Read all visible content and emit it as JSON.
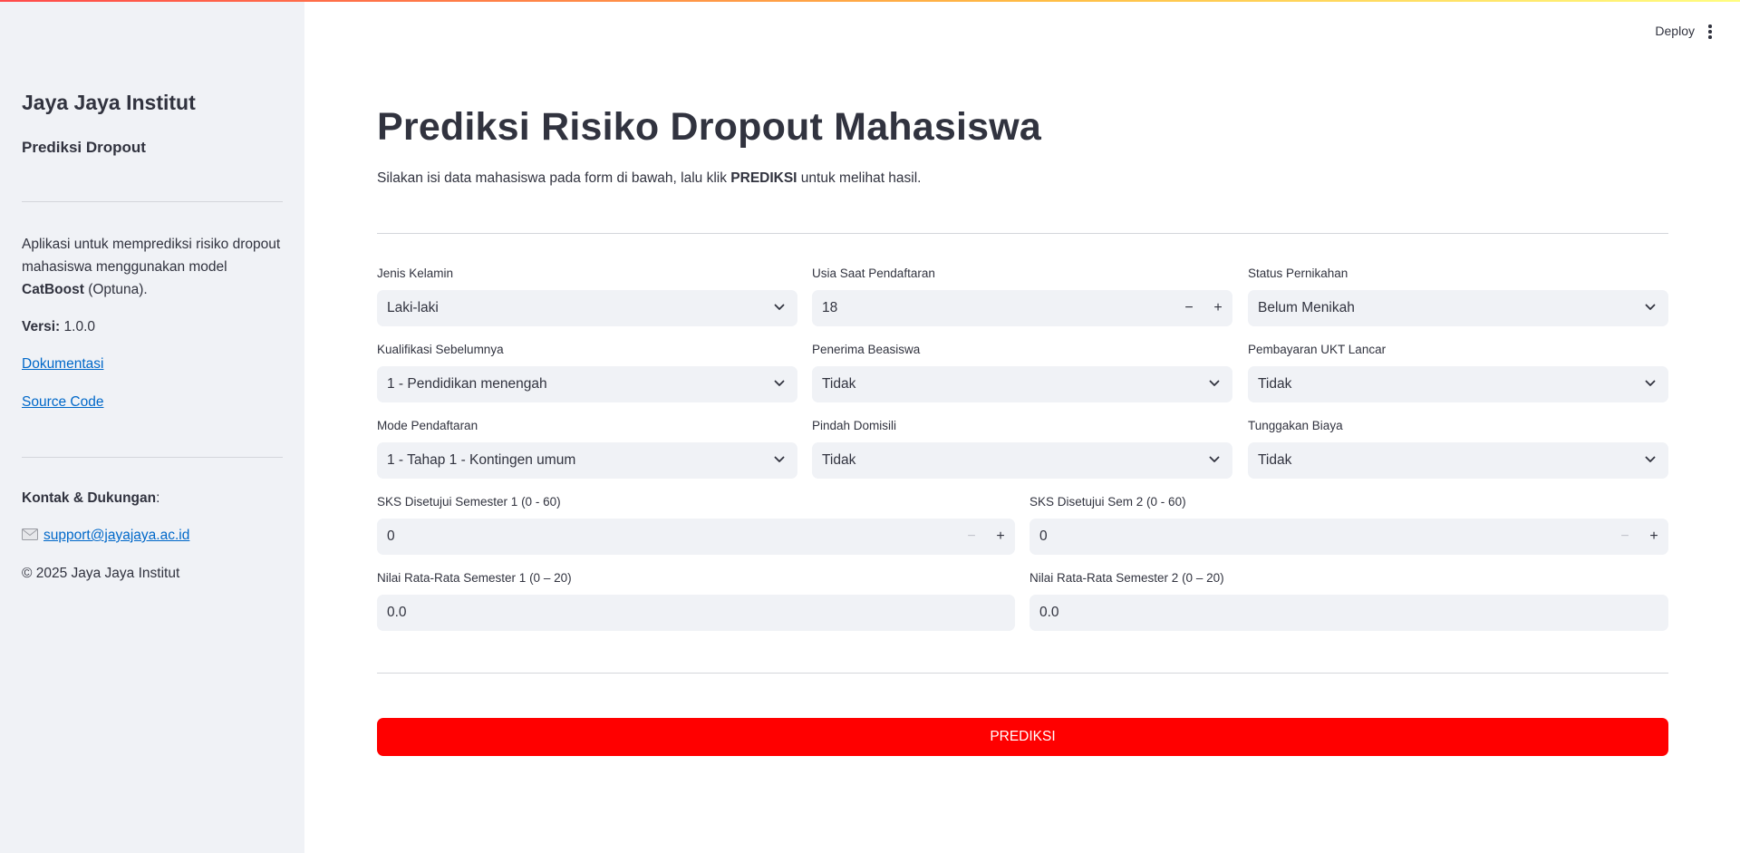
{
  "header": {
    "deploy_label": "Deploy",
    "menu_icon": "more-vertical-icon"
  },
  "sidebar": {
    "title": "Jaya Jaya Institut",
    "subtitle": "Prediksi Dropout",
    "description_prefix": "Aplikasi untuk memprediksi risiko dropout mahasiswa menggunakan model ",
    "description_model": "CatBoost",
    "description_suffix": " (Optuna).",
    "version_label": "Versi:",
    "version_value": " 1.0.0",
    "docs_link": "Dokumentasi",
    "source_link": "Source Code",
    "contact_label": "Kontak & Dukungan",
    "contact_colon": ":",
    "email": "support@jayajaya.ac.id",
    "mail_icon": "envelope-icon",
    "copyright": "© 2025 Jaya Jaya Institut"
  },
  "main": {
    "title": "Prediksi Risiko Dropout Mahasiswa",
    "intro_prefix": "Silakan isi data mahasiswa pada form di bawah, lalu klik ",
    "intro_bold": "PREDIKSI",
    "intro_suffix": " untuk melihat hasil.",
    "fields": {
      "jenis_kelamin": {
        "label": "Jenis Kelamin",
        "value": "Laki-laki"
      },
      "usia": {
        "label": "Usia Saat Pendaftaran",
        "value": "18"
      },
      "status_pernikahan": {
        "label": "Status Pernikahan",
        "value": "Belum Menikah"
      },
      "kualifikasi": {
        "label": "Kualifikasi Sebelumnya",
        "value": "1 - Pendidikan menengah"
      },
      "beasiswa": {
        "label": "Penerima Beasiswa",
        "value": "Tidak"
      },
      "ukt": {
        "label": "Pembayaran UKT Lancar",
        "value": "Tidak"
      },
      "mode": {
        "label": "Mode Pendaftaran",
        "value": "1 - Tahap 1 - Kontingen umum"
      },
      "domisili": {
        "label": "Pindah Domisili",
        "value": "Tidak"
      },
      "tunggakan": {
        "label": "Tunggakan Biaya",
        "value": "Tidak"
      },
      "sks1": {
        "label": "SKS Disetujui Semester 1 (0 - 60)",
        "value": "0"
      },
      "sks2": {
        "label": "SKS Disetujui Sem 2 (0 - 60)",
        "value": "0"
      },
      "nilai1": {
        "label": "Nilai Rata-Rata Semester 1 (0 – 20)",
        "value": "0.0"
      },
      "nilai2": {
        "label": "Nilai Rata-Rata Semester 2 (0 – 20)",
        "value": "0.0"
      }
    },
    "stepper_minus": "−",
    "stepper_plus": "+",
    "predict_button": "PREDIKSI"
  }
}
